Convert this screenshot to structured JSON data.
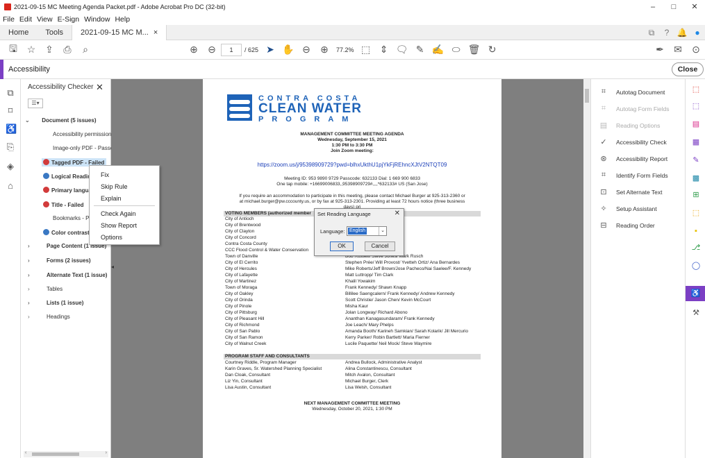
{
  "window": {
    "title": "2021-09-15 MC Meeting Agenda Packet.pdf - Adobe Acrobat Pro DC (32-bit)",
    "minimize": "–",
    "maximize": "□",
    "close": "✕"
  },
  "menu": [
    "File",
    "Edit",
    "View",
    "E-Sign",
    "Window",
    "Help"
  ],
  "tabs": {
    "home": "Home",
    "tools": "Tools",
    "doc": "2021-09-15 MC M...",
    "doc_close": "×"
  },
  "toolbar": {
    "page_current": "1",
    "page_total": "/ 625",
    "zoom": "77.2%"
  },
  "accessibility_bar": {
    "title": "Accessibility",
    "close": "Close"
  },
  "checker": {
    "title": "Accessibility Checker",
    "close": "✕",
    "items": [
      {
        "label": "Document (5 issues)",
        "arrow": "⌄",
        "status": "",
        "bold": true
      },
      {
        "label": "Accessibility permission fl",
        "arrow": "",
        "status": "",
        "bold": false
      },
      {
        "label": "Image-only PDF - Passed",
        "arrow": "",
        "status": "",
        "bold": false
      },
      {
        "label": "Tagged PDF - Failed",
        "arrow": "",
        "status": "fail",
        "bold": true
      },
      {
        "label": "Logical Reading",
        "arrow": "",
        "status": "help",
        "bold": true
      },
      {
        "label": "Primary language",
        "arrow": "",
        "status": "fail",
        "bold": true
      },
      {
        "label": "Title - Failed",
        "arrow": "",
        "status": "fail",
        "bold": true
      },
      {
        "label": "Bookmarks - Pas",
        "arrow": "",
        "status": "",
        "bold": false
      },
      {
        "label": "Color contrast - I",
        "arrow": "",
        "status": "help",
        "bold": true
      },
      {
        "label": "Page Content (1 issue)",
        "arrow": "›",
        "status": "",
        "bold": true
      },
      {
        "label": "Forms (2 issues)",
        "arrow": "›",
        "status": "",
        "bold": true
      },
      {
        "label": "Alternate Text (1 issue)",
        "arrow": "›",
        "status": "",
        "bold": true
      },
      {
        "label": "Tables",
        "arrow": "›",
        "status": "",
        "bold": false
      },
      {
        "label": "Lists (1 issue)",
        "arrow": "›",
        "status": "",
        "bold": true
      },
      {
        "label": "Headings",
        "arrow": "›",
        "status": "",
        "bold": false
      }
    ]
  },
  "context_menu": {
    "fix": "Fix",
    "skip": "Skip Rule",
    "explain": "Explain",
    "check_again": "Check Again",
    "show_report": "Show Report",
    "options": "Options"
  },
  "dialog": {
    "title": "Set Reading Language",
    "close": "✕",
    "label": "Language:",
    "value": "English",
    "ok": "OK",
    "cancel": "Cancel"
  },
  "tools_panel": [
    {
      "label": "Autotag Document",
      "icon": "tag-icon",
      "enabled": true
    },
    {
      "label": "Autotag Form Fields",
      "icon": "form-tag-icon",
      "enabled": false
    },
    {
      "label": "Reading Options",
      "icon": "reading-options-icon",
      "enabled": false
    },
    {
      "label": "Accessibility Check",
      "icon": "check-icon",
      "enabled": true
    },
    {
      "label": "Accessibility Report",
      "icon": "report-icon",
      "enabled": true
    },
    {
      "label": "Identify Form Fields",
      "icon": "identify-icon",
      "enabled": true
    },
    {
      "label": "Set Alternate Text",
      "icon": "alt-text-icon",
      "enabled": true
    },
    {
      "label": "Setup Assistant",
      "icon": "assistant-icon",
      "enabled": true
    },
    {
      "label": "Reading Order",
      "icon": "reading-order-icon",
      "enabled": true
    }
  ],
  "document": {
    "logo": {
      "line1": "CONTRA COSTA",
      "line2": "CLEAN WATER",
      "line3": "PROGRAM"
    },
    "heading": "MANAGEMENT COMMITTEE MEETING AGENDA",
    "date": "Wednesday, September 15, 2021",
    "time": "1:30 PM to 3:30 PM",
    "join": "Join Zoom meeting:",
    "zoom_link": "https://zoom.us/j/95398909729?pwd=blhxUkthU1pjYkFjREhncXJtV2NTQT09",
    "meeting_id": "Meeting ID: 953 9890 9729   Passcode: 632133   Dial: 1 669 900 6833",
    "one_tap": "One tap mobile: +16699006833,,95398909729#,,,,*632133# US (San Jose)",
    "accommodation_1": "If you require an accommodation to participate in this meeting, please contact Michael Burger at 925-313-2360 or",
    "accommodation_2a": "at",
    "accommodation_email": "michael.burger@pw.cccounty.us",
    "accommodation_2b": ", or by fax at 925-313-2301.  Providing at least 72 hours notice (three business",
    "accommodation_3": "days) pri",
    "voting_header": "VOTING MEMBERS (authorized member",
    "members": [
      [
        "City of Antioch",
        ""
      ],
      [
        "City of Brentwood",
        "r/ Allen Baquilar"
      ],
      [
        "City of Clayton",
        "hwartz"
      ],
      [
        "City of Concord",
        ""
      ],
      [
        "Contra Costa County",
        "en/ Allison Knapp"
      ],
      [
        "CCC Flood Control & Water Conservation",
        "so/ Allison Knapp"
      ],
      [
        "Town of Danville",
        "Bob Russell/ Steve Jones/ Mark Rusch"
      ],
      [
        "City of El Cerrito",
        "Stephen Prée/ Will Provost/ Yvetteh Ortiz/ Ana Bernardes"
      ],
      [
        "City of Hercules",
        "Mike Roberts/Jeff Brown/Jose Pacheco/Nai Saelee/F. Kennedy"
      ],
      [
        "City of Lafayette",
        "Matt Luttropp/ Tim Clark"
      ],
      [
        "City of Martinez",
        "Khalil Yowakim"
      ],
      [
        "Town of Moraga",
        "Frank Kennedy/ Shawn Knapp"
      ],
      [
        "City of Oakley",
        "Billilee Saengcalern/ Frank Kennedy/ Andrew Kennedy"
      ],
      [
        "City of Orinda",
        "Scott Christie/ Jason Chen/ Kevin McCourt"
      ],
      [
        "City of Pinole",
        "Misha Kaur"
      ],
      [
        "City of Pittsburg",
        "Jolan Longway/ Richard Abono"
      ],
      [
        "City of Pleasant Hill",
        "Ananthan Kanagasundaram/ Frank Kennedy"
      ],
      [
        "City of Richmond",
        "Joe Leach/ Mary Phelps"
      ],
      [
        "City of San Pablo",
        "Amanda Booth/ Karineh Samkian/ Sarah Kolarik/ Jill Mercurio"
      ],
      [
        "City of San Ramon",
        "Kerry Parker/ Robin Bartlett/ Maria Fierner"
      ],
      [
        "City of Walnut Creek",
        "Lucile Paquette/ Neil Mock/ Steve Waymire"
      ]
    ],
    "staff_header": "PROGRAM STAFF AND CONSULTANTS",
    "staff": [
      [
        "Courtney Riddle, Program Manager",
        "Andrea Bullock, Administrative Analyst"
      ],
      [
        "Karin Graves, Sr. Watershed Planning Specialist",
        "Alina Constantinescu, Consultant"
      ],
      [
        "Dan Cloak, Consultant",
        "Mitch Avalon, Consultant"
      ],
      [
        "Liz Yin, Consultant",
        "Michael Burger, Clerk"
      ],
      [
        "Lisa Austin, Consultant",
        "Lisa Welsh, Consultant"
      ]
    ],
    "next_meeting": "NEXT MANAGEMENT COMMITTEE MEETING",
    "next_date": "Wednesday, October 20, 2021, 1:30 PM"
  }
}
